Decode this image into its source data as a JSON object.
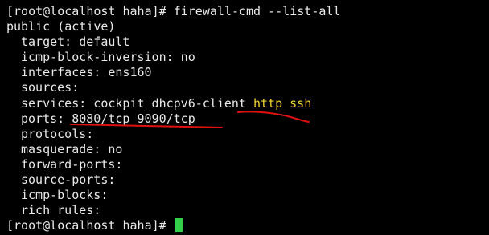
{
  "terminal": {
    "lines": [
      {
        "text": "[root@localhost haha]# firewall-cmd --list-all"
      },
      {
        "text": "public (active)"
      },
      {
        "text": "target: default"
      },
      {
        "text": "icmp-block-inversion: no"
      },
      {
        "text": "interfaces: ens160"
      },
      {
        "text": "sources:"
      },
      {
        "text": "services: cockpit dhcpv6-client ",
        "highlight": "http ssh"
      },
      {
        "text": "ports: 8080/tcp 9090/tcp"
      },
      {
        "text": "protocols:"
      },
      {
        "text": "masquerade: no"
      },
      {
        "text": "forward-ports:"
      },
      {
        "text": "source-ports:"
      },
      {
        "text": "icmp-blocks:"
      },
      {
        "text": "rich rules:"
      },
      {
        "text": "[root@localhost haha]# "
      }
    ]
  },
  "colors": {
    "background": "#000000",
    "text": "#e8e8e8",
    "highlight": "#f2d433",
    "cursor": "#32d04a",
    "annotation": "#e01010"
  }
}
